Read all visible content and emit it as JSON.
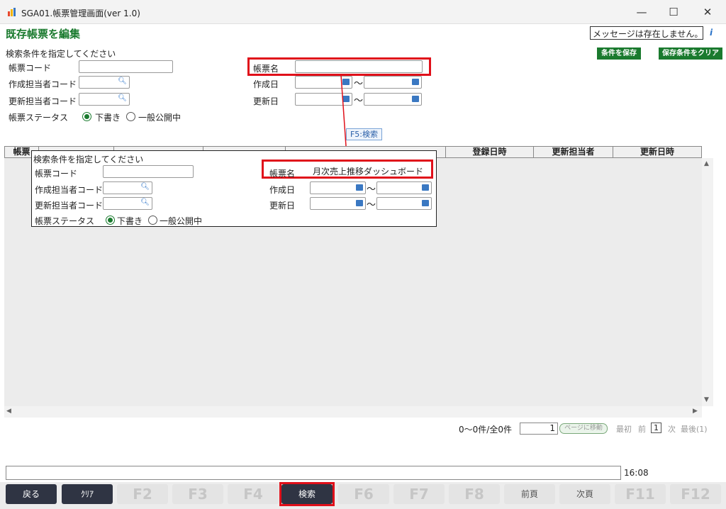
{
  "window": {
    "title": "SGA01.帳票管理画面(ver 1.0)",
    "minimize_icon": "—",
    "maximize_icon": "☐",
    "close_icon": "✕"
  },
  "page": {
    "heading": "既存帳票を編集",
    "message": "メッセージは存在しません。",
    "info_icon": "i",
    "save_conditions_label": "条件を保存",
    "clear_saved_conditions_label": "保存条件をクリア"
  },
  "search": {
    "section_title": "検索条件を指定してください",
    "report_code_label": "帳票コード",
    "report_code_value": "",
    "creator_code_label": "作成担当者コード",
    "updater_code_label": "更新担当者コード",
    "status_label": "帳票ステータス",
    "status_draft_label": "下書き",
    "status_public_label": "一般公開中",
    "report_name_label": "帳票名",
    "report_name_value": "",
    "created_date_label": "作成日",
    "updated_date_label": "更新日",
    "tilde": "〜",
    "search_button_label": "F5:検索"
  },
  "zoom": {
    "section_title": "検索条件を指定してください",
    "report_code_label": "帳票コード",
    "creator_code_label": "作成担当者コード",
    "updater_code_label": "更新担当者コード",
    "status_label": "帳票ステータス",
    "status_draft_label": "下書き",
    "status_public_label": "一般公開中",
    "report_name_label": "帳票名",
    "report_name_value": "月次売上推移ダッシュボード",
    "created_date_label": "作成日",
    "updated_date_label": "更新日",
    "tilde": "〜"
  },
  "grid": {
    "columns": [
      "帳票",
      "",
      "",
      "",
      "",
      "登録日時",
      "更新担当者",
      "更新日時"
    ],
    "scroll_up": "▲",
    "scroll_down": "▼",
    "scroll_left": "◀",
    "scroll_right": "▶"
  },
  "pager": {
    "count_text": "0〜0件/全0件",
    "page_value": "1",
    "move_label": "ページに移動",
    "first": "最初",
    "prev": "前",
    "current": "1",
    "next": "次",
    "last": "最後(1)"
  },
  "status": {
    "text": "",
    "clock": "16:08"
  },
  "fkeys": {
    "back": "戻る",
    "clear": "ｸﾘｱ",
    "f2": "F2",
    "f3": "F3",
    "f4": "F4",
    "search": "検索",
    "f6": "F6",
    "f7": "F7",
    "f8": "F8",
    "prev_page": "前頁",
    "next_page": "次頁",
    "f11": "F11",
    "f12": "F12"
  },
  "colors": {
    "accent_green": "#1a7a2e",
    "highlight_red": "#e0101a",
    "fkey_dark": "#2f3443"
  }
}
